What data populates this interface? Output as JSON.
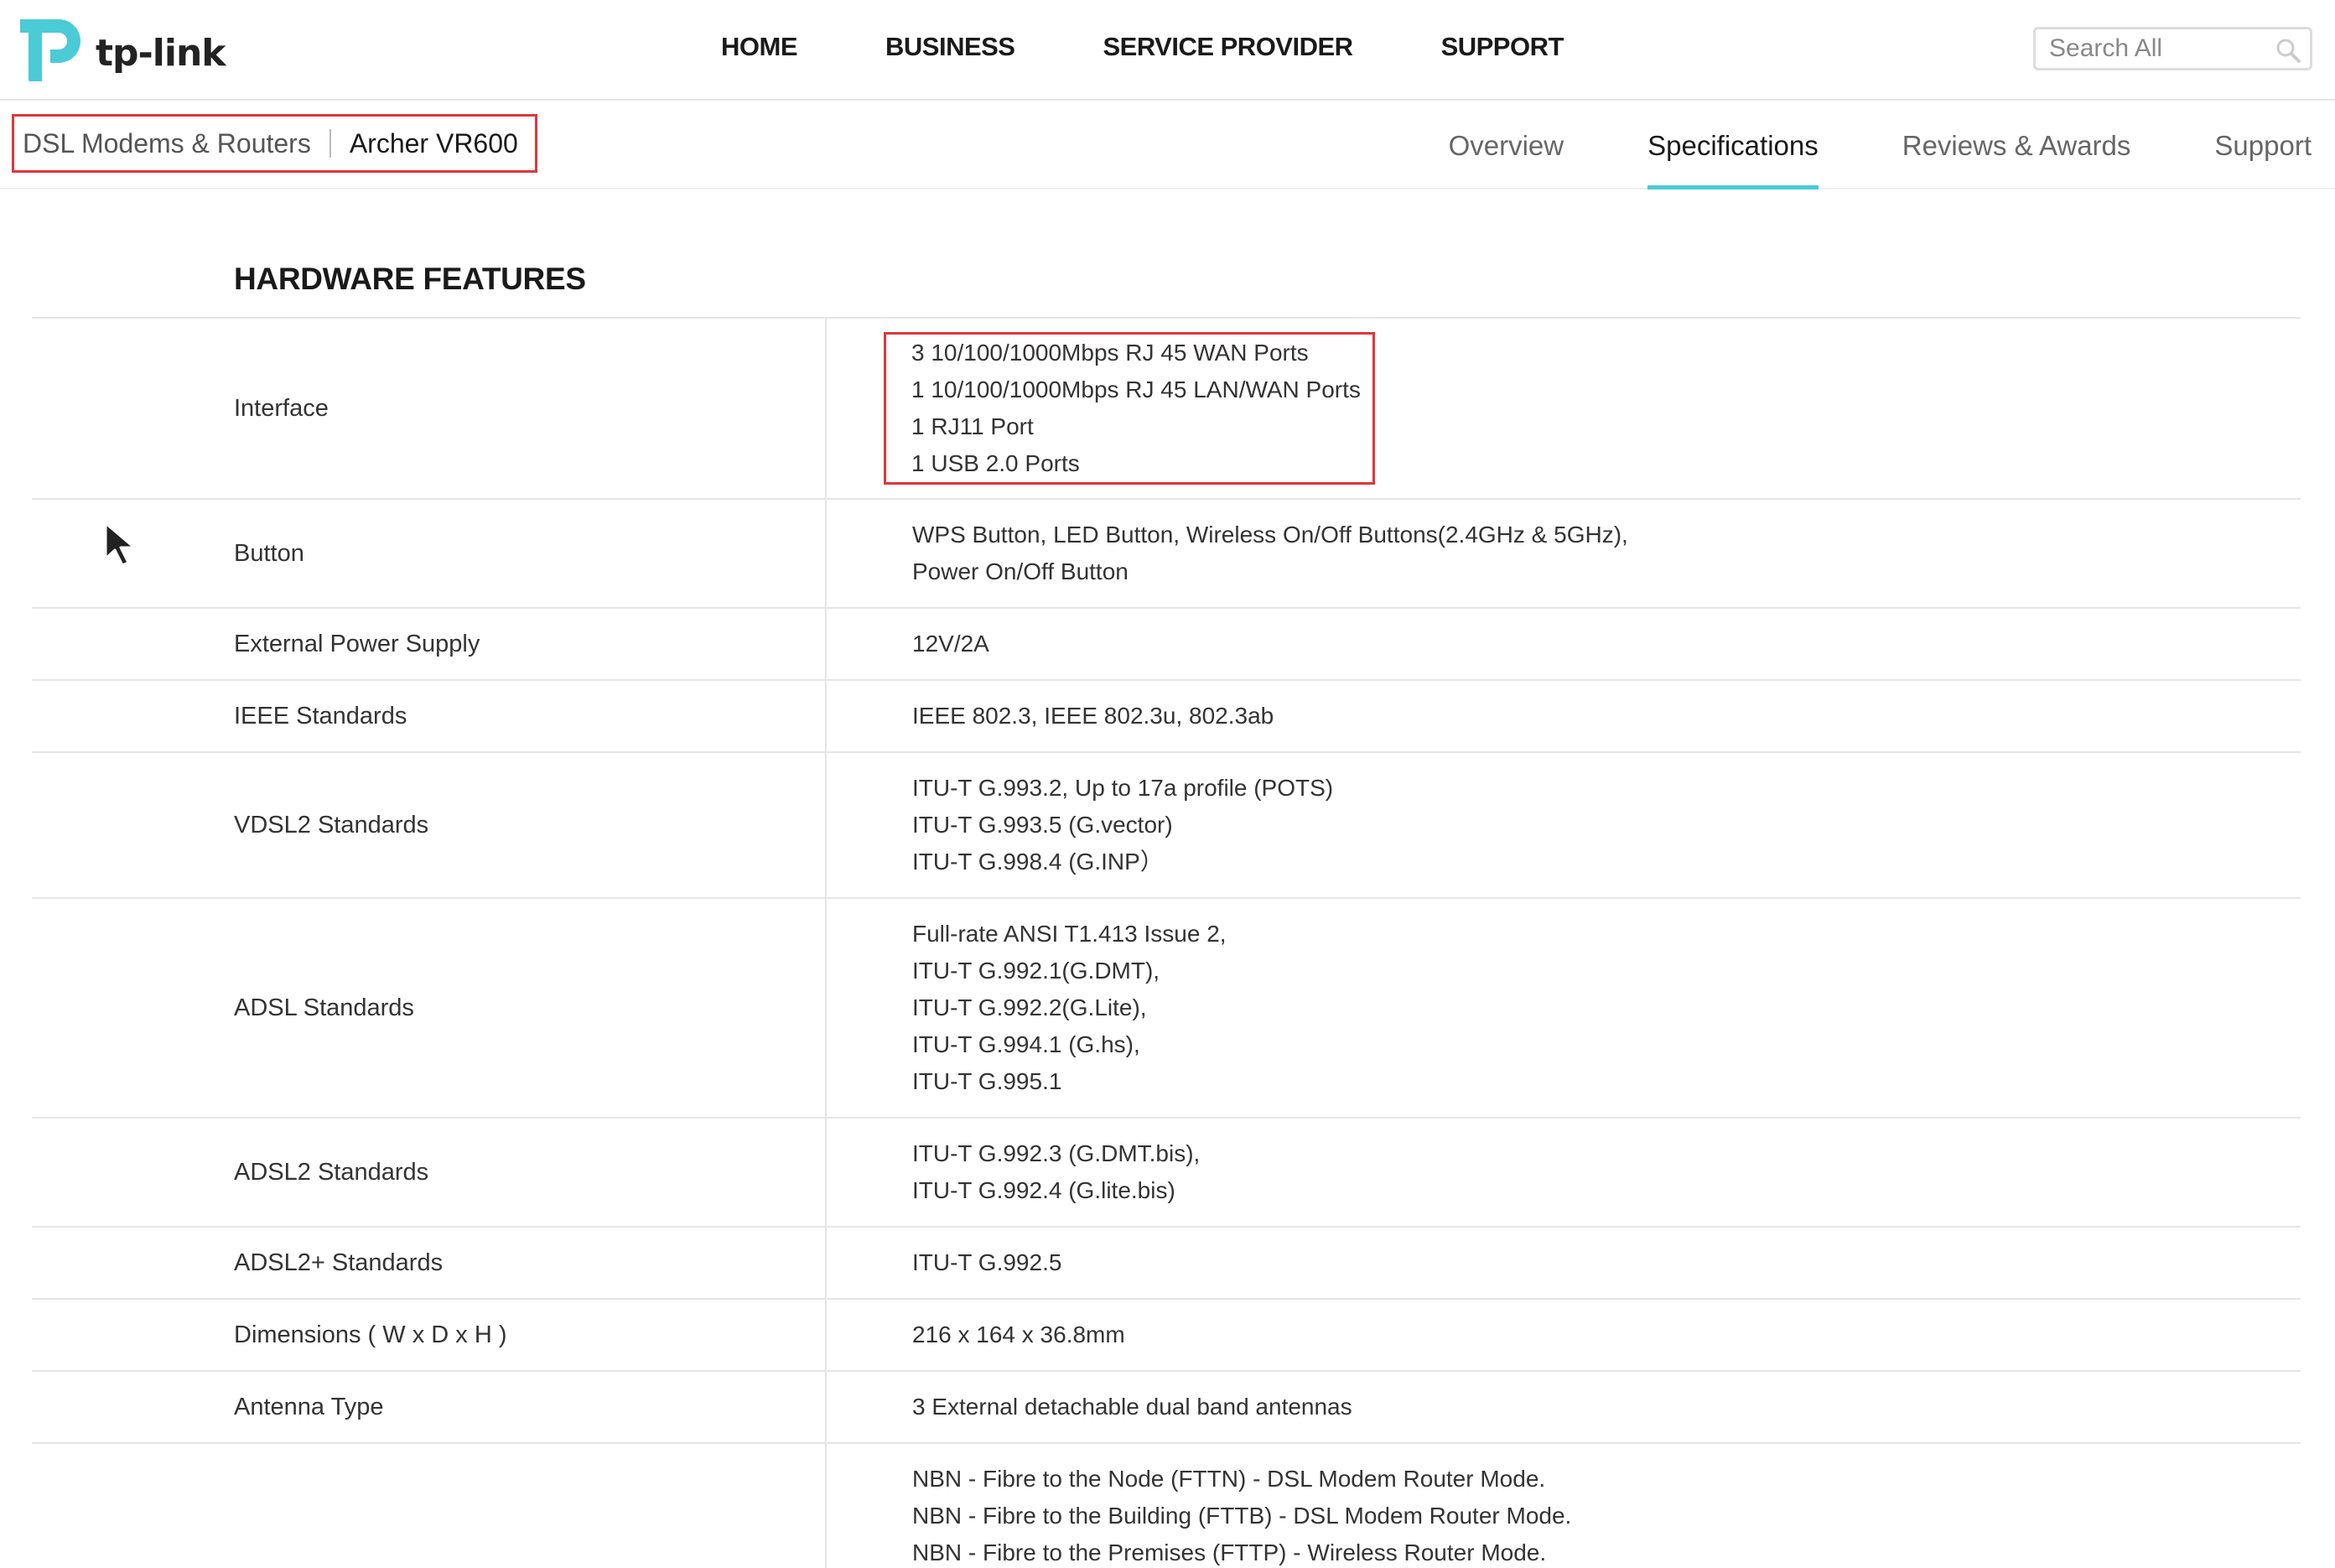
{
  "header": {
    "logo_text": "tp-link",
    "nav": [
      "HOME",
      "BUSINESS",
      "SERVICE PROVIDER",
      "SUPPORT"
    ],
    "search_placeholder": "Search All"
  },
  "breadcrumb": {
    "parent": "DSL Modems & Routers",
    "current": "Archer VR600"
  },
  "tabs": [
    {
      "label": "Overview",
      "active": false
    },
    {
      "label": "Specifications",
      "active": true
    },
    {
      "label": "Reviews & Awards",
      "active": false
    },
    {
      "label": "Support",
      "active": false
    }
  ],
  "colors": {
    "accent": "#4acbd6",
    "highlight_box": "#e0363c"
  },
  "section": {
    "title": "HARDWARE FEATURES",
    "rows": [
      {
        "label": "Interface",
        "values": [
          "3 10/100/1000Mbps RJ 45 WAN Ports",
          "1 10/100/1000Mbps RJ 45 LAN/WAN Ports",
          "1 RJ11 Port",
          "1 USB 2.0 Ports"
        ]
      },
      {
        "label": "Button",
        "values": [
          "WPS Button, LED Button, Wireless On/Off Buttons(2.4GHz & 5GHz),",
          "Power On/Off Button"
        ]
      },
      {
        "label": "External Power Supply",
        "values": [
          "12V/2A"
        ]
      },
      {
        "label": "IEEE Standards",
        "values": [
          "IEEE 802.3, IEEE 802.3u, 802.3ab"
        ]
      },
      {
        "label": "VDSL2 Standards",
        "values": [
          "ITU-T G.993.2, Up to 17a profile (POTS)",
          "ITU-T G.993.5 (G.vector)",
          "ITU-T G.998.4 (G.INP）"
        ]
      },
      {
        "label": "ADSL Standards",
        "values": [
          "Full-rate ANSI T1.413 Issue 2,",
          "ITU-T G.992.1(G.DMT),",
          "ITU-T G.992.2(G.Lite),",
          "ITU-T G.994.1 (G.hs),",
          "ITU-T G.995.1"
        ]
      },
      {
        "label": "ADSL2 Standards",
        "values": [
          "ITU-T G.992.3 (G.DMT.bis),",
          "ITU-T G.992.4 (G.lite.bis)"
        ]
      },
      {
        "label": "ADSL2+ Standards",
        "values": [
          "ITU-T G.992.5"
        ]
      },
      {
        "label": "Dimensions ( W x D x H )",
        "values": [
          "216 x 164 x 36.8mm"
        ]
      },
      {
        "label": "Antenna Type",
        "values": [
          "3 External detachable dual band antennas"
        ]
      },
      {
        "label": "",
        "values": [
          "NBN - Fibre to the Node (FTTN) - DSL Modem Router Mode.",
          "NBN - Fibre to the Building (FTTB) - DSL Modem Router Mode.",
          "NBN - Fibre to the Premises (FTTP) - Wireless Router Mode."
        ]
      }
    ]
  }
}
